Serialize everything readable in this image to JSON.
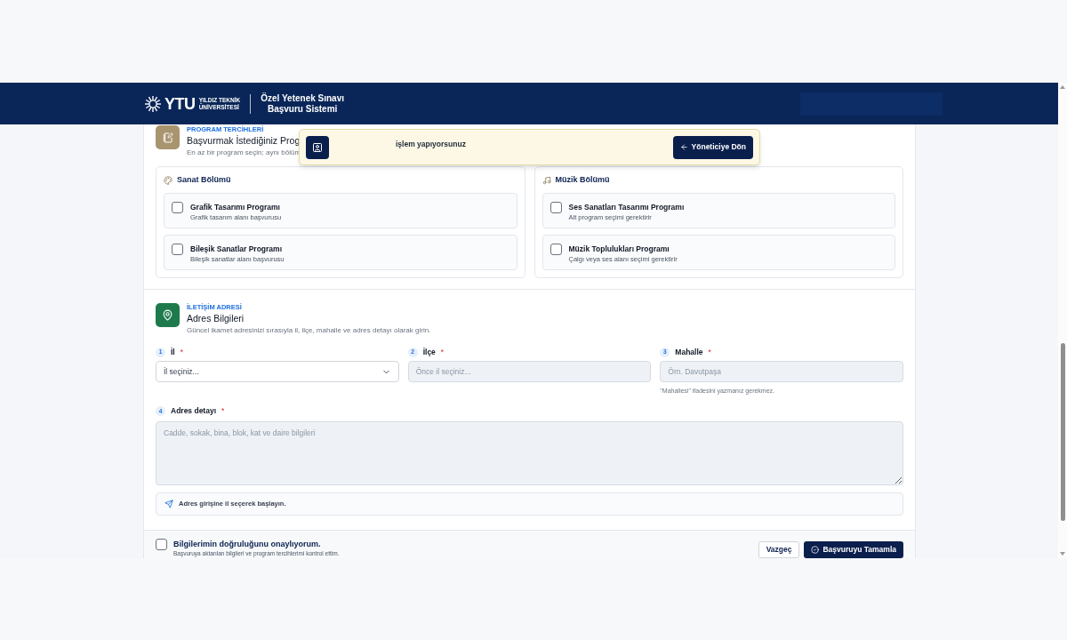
{
  "header": {
    "logo_text": "YTU",
    "university": [
      "YILDIZ TEKNİK",
      "ÜNİVERSİTESİ"
    ],
    "title": [
      "Özel Yetenek Sınavı",
      "Başvuru Sistemi"
    ]
  },
  "notice": {
    "text": "işlem yapıyorsunuz",
    "button": "Yöneticiye Dön"
  },
  "program_section": {
    "eyebrow": "PROGRAM TERCİHLERİ",
    "title": "Başvurmak İstediğiniz Prog",
    "subtitle": "En az bir program seçin; aynı bölüm",
    "groups": [
      {
        "name": "Sanat Bölümü",
        "kind": "art",
        "options": [
          {
            "title": "Grafik Tasarımı Programı",
            "description": "Grafik tasarım alanı başvurusu",
            "checked": false
          },
          {
            "title": "Bileşik Sanatlar Programı",
            "description": "Bileşik sanatlar alanı başvurusu",
            "checked": false
          }
        ]
      },
      {
        "name": "Müzik Bölümü",
        "kind": "music",
        "options": [
          {
            "title": "Ses Sanatları Tasarımı Programı",
            "description": "Alt program seçimi gerektirir",
            "checked": false
          },
          {
            "title": "Müzik Toplulukları Programı",
            "description": "Çalgı veya ses alanı seçimi gerektirir",
            "checked": false
          }
        ]
      }
    ]
  },
  "address_section": {
    "eyebrow": "İLETİŞİM ADRESİ",
    "title": "Adres Bilgileri",
    "subtitle": "Güncel ikamet adresinizi sırasıyla il, ilçe, mahalle ve adres detayı olarak girin.",
    "fields": [
      {
        "number": "1",
        "label": "İl",
        "required_mark": "*",
        "kind": "select",
        "placeholder": "İl seçiniz..."
      },
      {
        "number": "2",
        "label": "İlçe",
        "required_mark": "*",
        "kind": "input",
        "placeholder": "Önce il seçiniz..."
      },
      {
        "number": "3",
        "label": "Mahalle",
        "required_mark": "*",
        "kind": "input",
        "placeholder": "Örn. Davutpaşa",
        "hint": "\"Mahallesi\" ifadesini yazmanız gerekmez."
      }
    ],
    "detail": {
      "number": "4",
      "label": "Adres detayı",
      "required_mark": "*",
      "placeholder": "Cadde, sokak, bina, blok, kat ve daire bilgileri"
    },
    "info": "Adres girişine il seçerek başlayın."
  },
  "confirm": {
    "checked": false,
    "label": "Bilgilerimin doğruluğunu onaylıyorum.",
    "note": "Başvuruya aktarılan bilgileri ve program tercihlerimi kontrol ettim."
  },
  "buttons": [
    {
      "label": "Vazgeç",
      "kind": "secondary"
    },
    {
      "label": "Başvuruyu Tamamla",
      "kind": "primary"
    }
  ]
}
